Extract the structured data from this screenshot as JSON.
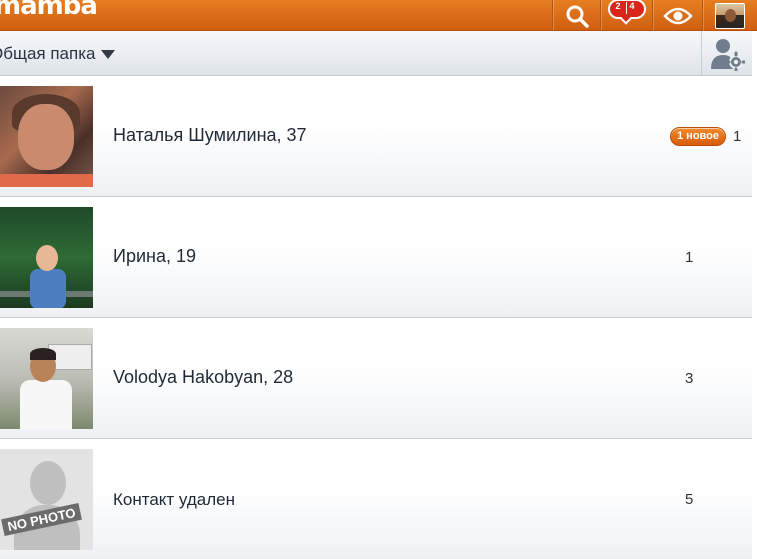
{
  "header": {
    "logo": "mamba",
    "search_icon": "search-icon",
    "messages": {
      "icon": "speech-bubble-icon",
      "count_left": "2",
      "count_right": "4"
    },
    "views_icon": "eye-icon",
    "accent_color": "#e0701a"
  },
  "folder": {
    "label": "Общая папка",
    "settings_icon": "contacts-settings-icon"
  },
  "contacts": [
    {
      "name": "Наталья Шумилина, 37",
      "badge": "1 новое",
      "count": "1"
    },
    {
      "name": "Ирина, 19",
      "count": "1"
    },
    {
      "name": "Volodya Hakobyan, 28",
      "count": "3"
    },
    {
      "name": "Контакт удален",
      "count": "5",
      "placeholder_label": "NO PHOTO"
    }
  ]
}
